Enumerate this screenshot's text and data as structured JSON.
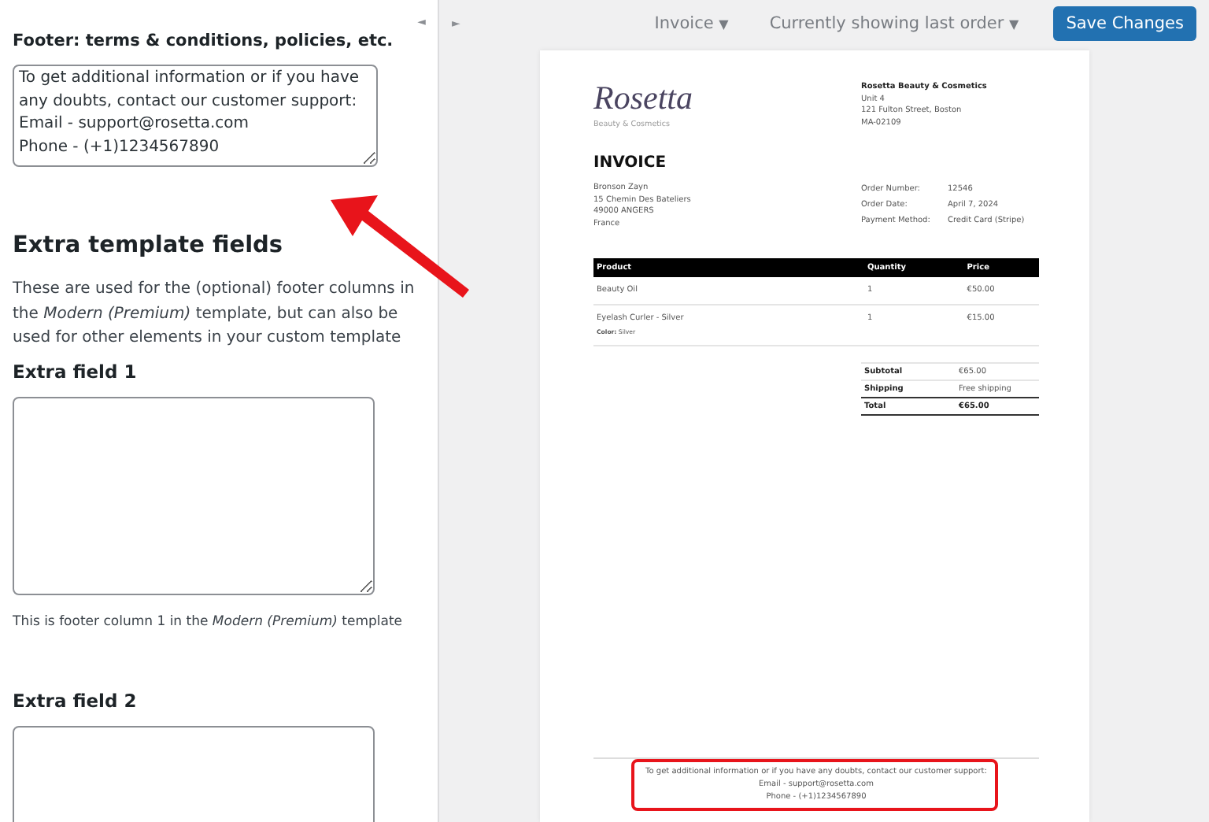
{
  "settings_panel": {
    "footer_label": "Footer: terms & conditions, policies, etc.",
    "footer_value": "To get additional information or if you have any doubts, contact our customer support:\nEmail - support@rosetta.com\nPhone - (+1)1234567890",
    "section_heading": "Extra template fields",
    "section_description": "These are used for the (optional) footer columns in the *Modern (Premium)* template, but can also be used for other elements in your custom template",
    "fields": [
      {
        "label": "Extra field 1",
        "help": "This is footer column 1 in the *Modern (Premium)* template"
      },
      {
        "label": "Extra field 2"
      }
    ]
  },
  "toolbar": {
    "collapse": "◄",
    "expand": "►",
    "document_type": {
      "label": "Invoice",
      "caret": "▼"
    },
    "order_preview": {
      "label": "Currently showing last order",
      "caret": "▼"
    },
    "save_button": "Save Changes"
  },
  "invoice": {
    "logo": {
      "name": "Rosetta",
      "tagline": "Beauty & Cosmetics"
    },
    "shop": {
      "name": "Rosetta Beauty & Cosmetics",
      "address": [
        "Unit 4",
        "121 Fulton Street, Boston",
        "MA-02109"
      ]
    },
    "title": "INVOICE",
    "billing_address": [
      "Bronson Zayn",
      "15 Chemin Des Bateliers",
      "49000 ANGERS",
      "France"
    ],
    "order_info": [
      {
        "label": "Order Number:",
        "value": "12546"
      },
      {
        "label": "Order Date:",
        "value": "April 7, 2024"
      },
      {
        "label": "Payment Method:",
        "value": "Credit Card (Stripe)"
      }
    ],
    "columns": [
      "Product",
      "Quantity",
      "Price"
    ],
    "rows": [
      {
        "product": "Beauty Oil",
        "quantity": "1",
        "price": "€50.00"
      },
      {
        "product": "Eyelash Curler - Silver",
        "meta": "**Color:** Silver",
        "quantity": "1",
        "price": "€15.00"
      }
    ],
    "totals": [
      {
        "label": "Subtotal",
        "value": "€65.00",
        "bold": false
      },
      {
        "label": "Shipping",
        "value": "Free shipping",
        "bold": false
      },
      {
        "label": "Total",
        "value": "€65.00",
        "bold": true
      }
    ],
    "footer": [
      "To get additional information or if you have any doubts, contact our customer support:",
      "Email - support@rosetta.com",
      "Phone - (+1)1234567890"
    ]
  }
}
